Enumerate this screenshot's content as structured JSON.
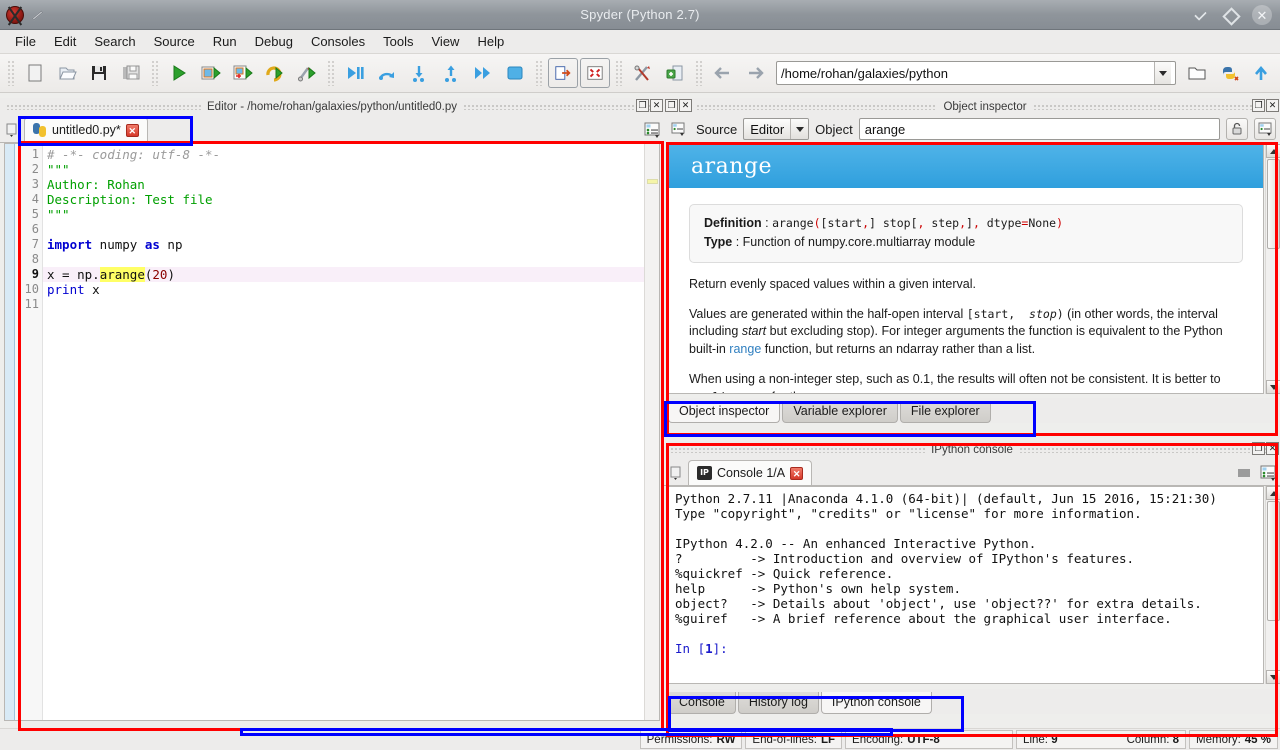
{
  "window": {
    "title": "Spyder (Python 2.7)",
    "logo_icon": "spyder-logo-icon",
    "pin_icon": "pin-icon",
    "minimize_icon": "minimize-icon",
    "maximize_icon": "maximize-icon",
    "close_icon": "close-icon"
  },
  "menubar": {
    "items": [
      {
        "label": "File"
      },
      {
        "label": "Edit"
      },
      {
        "label": "Search"
      },
      {
        "label": "Source"
      },
      {
        "label": "Run"
      },
      {
        "label": "Debug"
      },
      {
        "label": "Consoles"
      },
      {
        "label": "Tools"
      },
      {
        "label": "View"
      },
      {
        "label": "Help"
      }
    ]
  },
  "toolbar": {
    "buttons": [
      {
        "name": "new-file-icon",
        "tip": "New file"
      },
      {
        "name": "open-file-icon",
        "tip": "Open file"
      },
      {
        "name": "save-file-icon",
        "tip": "Save file"
      },
      {
        "name": "save-all-icon",
        "tip": "Save all"
      },
      {
        "name": "run-file-icon",
        "tip": "Run file"
      },
      {
        "name": "run-cell-icon",
        "tip": "Run current cell"
      },
      {
        "name": "run-cell-advance-icon",
        "tip": "Run current cell and go to next one"
      },
      {
        "name": "rerun-icon",
        "tip": "Re-run last script"
      },
      {
        "name": "configure-run-icon",
        "tip": "Run settings"
      },
      {
        "name": "debug-file-icon",
        "tip": "Debug file"
      },
      {
        "name": "step-over-icon",
        "tip": "Run current line"
      },
      {
        "name": "step-into-icon",
        "tip": "Step into function"
      },
      {
        "name": "step-return-icon",
        "tip": "Run until function returns"
      },
      {
        "name": "continue-icon",
        "tip": "Continue execution"
      },
      {
        "name": "stop-debug-icon",
        "tip": "Stop debugging"
      },
      {
        "name": "maximize-pane-icon",
        "tip": "Maximize current pane"
      },
      {
        "name": "fullscreen-icon",
        "tip": "Fullscreen mode"
      },
      {
        "name": "preferences-icon",
        "tip": "Preferences"
      },
      {
        "name": "pythonpath-icon",
        "tip": "PYTHONPATH manager"
      }
    ],
    "path_value": "/home/rohan/galaxies/python",
    "path_dropdown_icon": "chevron-down-icon",
    "browse_icon": "folder-icon",
    "python-path-icon": "python-path-icon",
    "parent-dir-icon": "arrow-up-icon",
    "back_icon": "arrow-left-icon",
    "forward_icon": "arrow-right-icon"
  },
  "editor": {
    "panel_title": "Editor - /home/rohan/galaxies/python/untitled0.py",
    "undock_icon": "undock-icon",
    "close_pane_icon": "close-pane-icon",
    "browse_tabs_icon": "browse-tabs-icon",
    "options_icon": "options-icon",
    "tab": {
      "label": "untitled0.py*",
      "file_icon": "python-file-icon",
      "close_icon": "close-tab-icon"
    },
    "lines": [
      {
        "n": "1",
        "tokens": [
          {
            "t": "# -*- coding: utf-8 -*-",
            "c": "c-comment"
          }
        ]
      },
      {
        "n": "2",
        "tokens": [
          {
            "t": "\"\"\"",
            "c": "c-str"
          }
        ]
      },
      {
        "n": "3",
        "tokens": [
          {
            "t": "Author: Rohan",
            "c": "c-str"
          }
        ]
      },
      {
        "n": "4",
        "tokens": [
          {
            "t": "Description: Test file",
            "c": "c-str"
          }
        ]
      },
      {
        "n": "5",
        "tokens": [
          {
            "t": "\"\"\"",
            "c": "c-str"
          }
        ]
      },
      {
        "n": "6",
        "tokens": []
      },
      {
        "n": "7",
        "tokens": [
          {
            "t": "import",
            "c": "c-kw"
          },
          {
            "t": " numpy ",
            "c": ""
          },
          {
            "t": "as",
            "c": "c-kw"
          },
          {
            "t": " np",
            "c": ""
          }
        ]
      },
      {
        "n": "8",
        "tokens": []
      },
      {
        "n": "9",
        "tokens": [
          {
            "t": "x = np.",
            "c": ""
          },
          {
            "t": "arange",
            "c": "c-hl"
          },
          {
            "t": "(",
            "c": ""
          },
          {
            "t": "20",
            "c": "c-num"
          },
          {
            "t": ")",
            "c": ""
          }
        ],
        "current": true
      },
      {
        "n": "10",
        "tokens": [
          {
            "t": "print",
            "c": "c-bi"
          },
          {
            "t": " x",
            "c": ""
          }
        ]
      },
      {
        "n": "11",
        "tokens": []
      }
    ]
  },
  "object_inspector": {
    "panel_title": "Object inspector",
    "undock_icon": "undock-icon",
    "close_pane_icon": "close-pane-icon",
    "source_label": "Source",
    "source_value": "Editor",
    "source_dropdown_icon": "chevron-down-icon",
    "object_label": "Object",
    "object_value": "arange",
    "lock_icon": "lock-icon",
    "options_icon": "options-icon",
    "doc": {
      "title": "arange",
      "definition_label": "Definition",
      "definition_value": "arange([start,] stop[, step,], dtype=None)",
      "type_label": "Type",
      "type_value": "Function of numpy.core.multiarray module",
      "paragraphs": [
        "Return evenly spaced values within a given interval.",
        "Values are generated within the half-open interval [start, stop) (in other words, the interval including start but excluding stop). For integer arguments the function is equivalent to the Python built-in range function, but returns an ndarray rather than a list.",
        "When using a non-integer step, such as 0.1, the results will often not be consistent. It is better to use linspace for these cases."
      ]
    },
    "tabs": [
      {
        "label": "Object inspector",
        "active": true
      },
      {
        "label": "Variable explorer",
        "active": false
      },
      {
        "label": "File explorer",
        "active": false
      }
    ]
  },
  "console": {
    "panel_title": "IPython console",
    "undock_icon": "undock-icon",
    "close_pane_icon": "close-pane-icon",
    "browse_tabs_icon": "browse-tabs-icon",
    "stop_icon": "stop-icon",
    "options_icon": "options-icon",
    "tab": {
      "label": "Console 1/A",
      "icon": "ipython-icon",
      "close_icon": "close-tab-icon"
    },
    "output_lines": [
      "Python 2.7.11 |Anaconda 4.1.0 (64-bit)| (default, Jun 15 2016, 15:21:30)",
      "Type \"copyright\", \"credits\" or \"license\" for more information.",
      "",
      "IPython 4.2.0 -- An enhanced Interactive Python.",
      "?         -> Introduction and overview of IPython's features.",
      "%quickref -> Quick reference.",
      "help      -> Python's own help system.",
      "object?   -> Details about 'object', use 'object??' for extra details.",
      "%guiref   -> A brief reference about the graphical user interface.",
      ""
    ],
    "prompt": "In [1]:",
    "prompt_number": "1",
    "tabs": [
      {
        "label": "Console",
        "active": false
      },
      {
        "label": "History log",
        "active": false
      },
      {
        "label": "IPython console",
        "active": true
      }
    ]
  },
  "statusbar": {
    "permissions_label": "Permissions:",
    "permissions_value": "RW",
    "eol_label": "End-of-lines:",
    "eol_value": "LF",
    "encoding_label": "Encoding:",
    "encoding_value": "UTF-8",
    "line_label": "Line:",
    "line_value": "9",
    "column_label": "Column:",
    "column_value": "8",
    "memory_label": "Memory:",
    "memory_value": "45 %"
  },
  "annotations": {
    "red_color": "#ff0000",
    "blue_color": "#0000ff"
  }
}
